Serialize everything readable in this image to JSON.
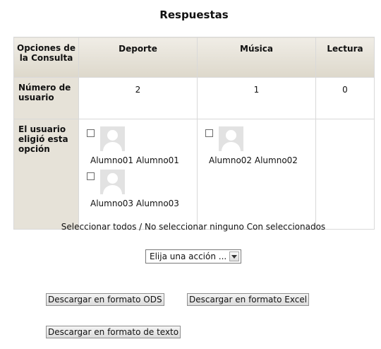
{
  "title": "Respuestas",
  "table": {
    "corner_header": "Opciones de la Consulta",
    "options": [
      "Deporte",
      "Música",
      "Lectura"
    ],
    "count_label": "Número de usuario",
    "counts": [
      "2",
      "1",
      "0"
    ],
    "users_label": "El usuario eligió esta opción",
    "users": {
      "deporte": [
        "Alumno01 Alumno01",
        "Alumno03 Alumno03"
      ],
      "musica": [
        "Alumno02 Alumno02"
      ]
    }
  },
  "select_all": "Seleccionar todos",
  "separator": " / ",
  "select_none": "No seleccionar ninguno",
  "with_selected": "Con seleccionados",
  "action_select": {
    "value": "Elija una acción ..."
  },
  "buttons": {
    "ods": "Descargar en formato ODS",
    "excel": "Descargar en formato Excel",
    "text": "Descargar en formato de texto"
  }
}
